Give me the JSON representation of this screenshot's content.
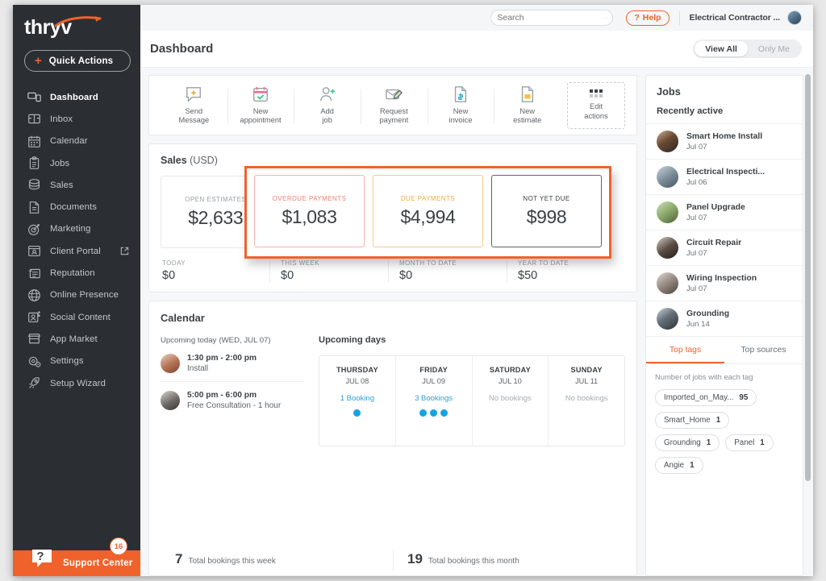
{
  "brand": {
    "name": "thryv",
    "accent": "#f0622b"
  },
  "sidebar": {
    "quick_actions_label": "Quick Actions",
    "items": [
      {
        "label": "Dashboard",
        "icon": "dashboard-icon",
        "active": true
      },
      {
        "label": "Inbox",
        "icon": "inbox-icon"
      },
      {
        "label": "Calendar",
        "icon": "calendar-icon"
      },
      {
        "label": "Jobs",
        "icon": "clipboard-icon"
      },
      {
        "label": "Sales",
        "icon": "coins-icon"
      },
      {
        "label": "Documents",
        "icon": "document-icon"
      },
      {
        "label": "Marketing",
        "icon": "target-icon"
      },
      {
        "label": "Client Portal",
        "icon": "portal-icon",
        "external": true
      },
      {
        "label": "Reputation",
        "icon": "reputation-icon"
      },
      {
        "label": "Online Presence",
        "icon": "globe-icon"
      },
      {
        "label": "Social Content",
        "icon": "social-icon"
      },
      {
        "label": "App Market",
        "icon": "store-icon"
      },
      {
        "label": "Settings",
        "icon": "gear-icon"
      },
      {
        "label": "Setup Wizard",
        "icon": "rocket-icon"
      }
    ],
    "support": {
      "label": "Support Center",
      "badge": "16"
    }
  },
  "topbar": {
    "search_placeholder": "Search",
    "search_value": "",
    "help_label": "Help",
    "account_name": "Electrical Contractor ..."
  },
  "header": {
    "title": "Dashboard",
    "toggle": {
      "options": [
        "View All",
        "Only Me"
      ],
      "selected": "View All"
    }
  },
  "quick_action_bar": {
    "actions": [
      {
        "line1": "Send",
        "line2": "Message",
        "icon": "message-plus-icon"
      },
      {
        "line1": "New",
        "line2": "appointment",
        "icon": "calendar-check-icon"
      },
      {
        "line1": "Add",
        "line2": "job",
        "icon": "user-plus-icon"
      },
      {
        "line1": "Request",
        "line2": "payment",
        "icon": "request-payment-icon"
      },
      {
        "line1": "New",
        "line2": "invoice",
        "icon": "invoice-icon"
      },
      {
        "line1": "New",
        "line2": "estimate",
        "icon": "estimate-icon"
      }
    ],
    "edit": {
      "line1": "Edit",
      "line2": "actions",
      "icon": "grid-dots-icon"
    }
  },
  "sales": {
    "title": "Sales",
    "currency": "(USD)",
    "open_estimates": {
      "label": "OPEN ESTIMATES",
      "value": "$2,633"
    },
    "highlight_cards": [
      {
        "label": "OVERDUE PAYMENTS",
        "value": "$1,083",
        "style": "red"
      },
      {
        "label": "DUE PAYMENTS",
        "value": "$4,994",
        "style": "amber"
      },
      {
        "label": "NOT YET DUE",
        "value": "$998",
        "style": "dark"
      }
    ],
    "stats": [
      {
        "label": "TODAY",
        "value": "$0"
      },
      {
        "label": "THIS WEEK",
        "value": "$0"
      },
      {
        "label": "MONTH TO DATE",
        "value": "$0"
      },
      {
        "label": "YEAR TO DATE",
        "value": "$50"
      }
    ]
  },
  "calendar": {
    "title": "Calendar",
    "upcoming_today_label": "Upcoming today",
    "upcoming_today_date": "(WED, JUL 07)",
    "appointments": [
      {
        "time": "1:30 pm - 2:00 pm",
        "desc": "Install"
      },
      {
        "time": "5:00 pm - 6:00 pm",
        "desc": "Free Consultation - 1 hour"
      }
    ],
    "upcoming_days_label": "Upcoming days",
    "days": [
      {
        "name": "THURSDAY",
        "date": "JUL 08",
        "bookings": "1 Booking",
        "dots": 1
      },
      {
        "name": "FRIDAY",
        "date": "JUL 09",
        "bookings": "3 Bookings",
        "dots": 3
      },
      {
        "name": "SATURDAY",
        "date": "JUL 10",
        "bookings": "No bookings",
        "dots": 0
      },
      {
        "name": "SUNDAY",
        "date": "JUL 11",
        "bookings": "No bookings",
        "dots": 0
      }
    ],
    "totals": [
      {
        "num": "7",
        "label": "Total bookings this week"
      },
      {
        "num": "19",
        "label": "Total bookings this month"
      }
    ]
  },
  "jobs": {
    "title": "Jobs",
    "subtitle": "Recently active",
    "rows": [
      {
        "name": "Smart Home Install",
        "date": "Jul 07"
      },
      {
        "name": "Electrical Inspecti...",
        "date": "Jul 06"
      },
      {
        "name": "Panel Upgrade",
        "date": "Jul 07"
      },
      {
        "name": "Circuit Repair",
        "date": "Jul 07"
      },
      {
        "name": "Wiring Inspection",
        "date": "Jul 07"
      },
      {
        "name": "Grounding",
        "date": "Jun 14"
      }
    ],
    "tabs": [
      {
        "label": "Top tags",
        "selected": true
      },
      {
        "label": "Top sources",
        "selected": false
      }
    ],
    "tags_note": "Number of jobs with each tag",
    "tags": [
      {
        "name": "Imported_on_May...",
        "count": "95"
      },
      {
        "name": "Smart_Home",
        "count": "1"
      },
      {
        "name": "Grounding",
        "count": "1"
      },
      {
        "name": "Panel",
        "count": "1"
      },
      {
        "name": "Angie",
        "count": "1"
      }
    ]
  }
}
